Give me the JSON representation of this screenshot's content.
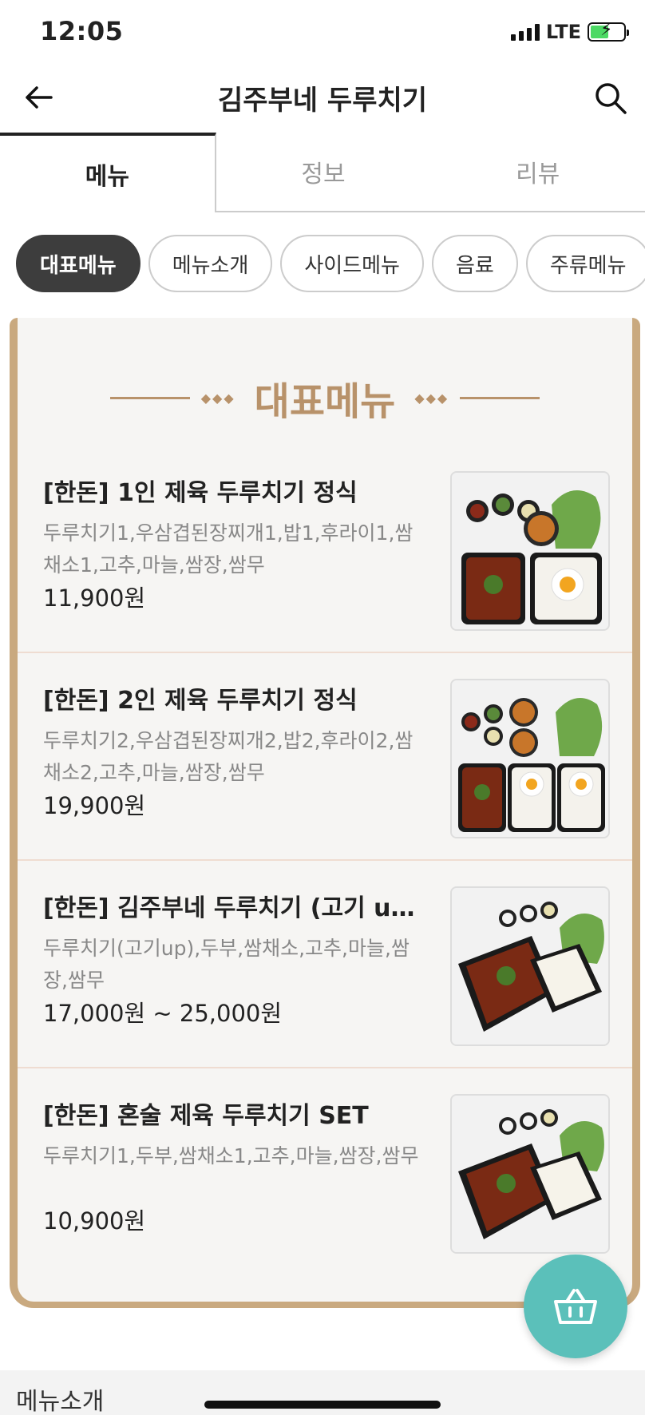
{
  "status_bar": {
    "time": "12:05",
    "network": "LTE"
  },
  "header": {
    "title": "김주부네 두루치기"
  },
  "tabs": [
    {
      "label": "메뉴",
      "active": true
    },
    {
      "label": "정보",
      "active": false
    },
    {
      "label": "리뷰",
      "active": false
    }
  ],
  "categories": [
    {
      "label": "대표메뉴",
      "active": true
    },
    {
      "label": "메뉴소개",
      "active": false
    },
    {
      "label": "사이드메뉴",
      "active": false
    },
    {
      "label": "음료",
      "active": false
    },
    {
      "label": "주류메뉴",
      "active": false
    }
  ],
  "section": {
    "heading": "대표메뉴"
  },
  "menu_items": [
    {
      "title": "[한돈] 1인 제육 두루치기 정식",
      "description": "두루치기1,우삼겹된장찌개1,밥1,후라이1,쌈채소1,고추,마늘,쌈장,쌈무",
      "price": "11,900원"
    },
    {
      "title": "[한돈] 2인 제육 두루치기 정식",
      "description": "두루치기2,우삼겹된장찌개2,밥2,후라이2,쌈채소2,고추,마늘,쌈장,쌈무",
      "price": "19,900원"
    },
    {
      "title": "[한돈] 김주부네 두루치기 (고기 up…",
      "description": "두루치기(고기up),두부,쌈채소,고추,마늘,쌈장,쌈무",
      "price": "17,000원 ~ 25,000원"
    },
    {
      "title": "[한돈] 혼술 제육 두루치기 SET",
      "description": "두루치기1,두부,쌈채소1,고추,마늘,쌈장,쌈무",
      "price": "10,900원"
    }
  ],
  "bottom": {
    "section_label": "메뉴소개"
  },
  "colors": {
    "accent_gold": "#c9a97f",
    "cart": "#5bc0ba",
    "chip_active": "#3d3d3d"
  }
}
